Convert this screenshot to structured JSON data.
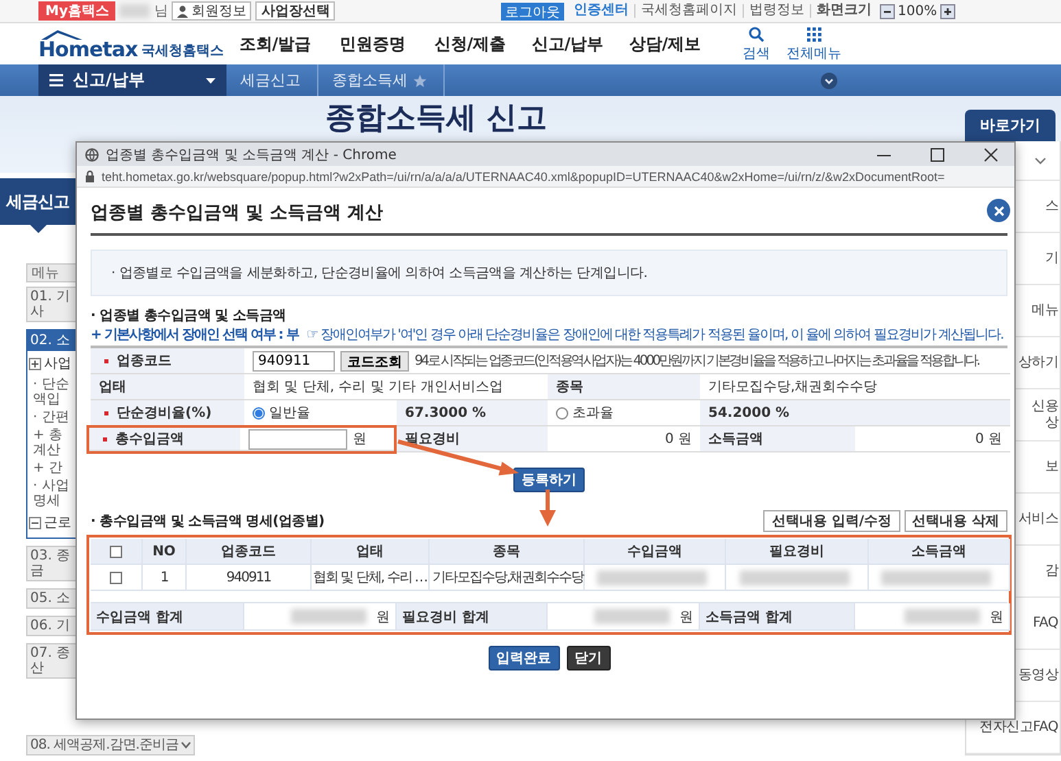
{
  "top_bar": {
    "my_button": "My홈택스",
    "user_suffix": "님",
    "member_info": "회원정보",
    "workplace": "사업장선택",
    "logout": "로그아웃",
    "cert": "인증센터",
    "links": [
      "국세청홈페이지",
      "법령정보"
    ],
    "zoom": {
      "label": "화면크기",
      "value": "100%"
    }
  },
  "header": {
    "logo": "Hometax",
    "logo_sub": "국세청홈택스",
    "nav": [
      "조회/발급",
      "민원증명",
      "신청/제출",
      "신고/납부",
      "상담/제보"
    ],
    "tools": [
      {
        "kind": "search",
        "label": "검색"
      },
      {
        "kind": "menu",
        "label": "전체메뉴"
      }
    ]
  },
  "breadcrumb": {
    "menu": "신고/납부",
    "items": [
      {
        "label": "세금신고"
      },
      {
        "label": "종합소득세",
        "favorite": false
      }
    ]
  },
  "banner": {
    "title": "종합소득세 신고"
  },
  "left_panel": {
    "title": "세금신고",
    "tab": "메뉴",
    "steps": [
      {
        "label": "01. 기\n사",
        "selected": false
      },
      {
        "label": "02. 소",
        "selected": true,
        "children": [
          {
            "label": "사업",
            "open": false,
            "children": [
              {
                "label": "· 단순\n액입"
              },
              {
                "label": "· 간편"
              },
              {
                "label": "+ 총\n계산"
              },
              {
                "label": "+ 간"
              },
              {
                "label": "· 사업\n명세"
              }
            ]
          },
          {
            "label": "근로",
            "open": true
          }
        ]
      },
      {
        "label": "03. 종\n금",
        "selected": false
      },
      {
        "label": "05. 소",
        "selected": false
      },
      {
        "label": "06. 기",
        "selected": false
      },
      {
        "label": "07. 종\n산",
        "selected": false
      },
      {
        "label": "08. 세액공제.감면.준비금",
        "selected": false,
        "dropdown": true
      }
    ]
  },
  "right_panel": {
    "title": "바로가기",
    "items": [
      "스",
      "기",
      "메뉴",
      "상하기",
      "신용\n상",
      "보",
      "서비스",
      "감",
      "FAQ",
      "동영상",
      "전자신고FAQ"
    ]
  },
  "popup": {
    "window_title": "업종별 총수입금액 및 소득금액 계산 - Chrome",
    "url": "teht.hometax.go.kr/websquare/popup.html?w2xPath=/ui/rn/a/a/a/a/UTERNAAC40.xml&popupID=UTERNAAC40&w2xHome=/ui/rn/z/&w2xDocumentRoot=",
    "heading": "업종별 총수입금액 및 소득금액 계산",
    "info": "· 업종별로 수입금액을 세분화하고, 단순경비율에 의하여 소득금액을 계산하는 단계입니다.",
    "section1": "· 업종별 총수입금액 및 소득금액",
    "note_label": "+ 기본사항에서 장애인 선택 여부 : 부",
    "note": "☞ 장애인여부가 '여'인 경우 아래 단순경비율은 장애인에 대한 적용특례가 적용된 율이며, 이 율에 의하여 필요경비가 계산됩니다.",
    "form_rows": [
      [
        {
          "kind": "label",
          "text": "업종코드",
          "required": true
        },
        {
          "kind": "code",
          "value": "940911",
          "button": "코드조회",
          "hint": "94로 시작되는 업종코드(인적용역사업자)는 4000만원까지 기본경비율을 적용하고 나머지는 초과율을 적용합니다."
        }
      ],
      [
        {
          "kind": "label",
          "text": "업태",
          "required": false
        },
        {
          "kind": "text",
          "text": "협회 및 단체, 수리 및 기타 개인서비스업"
        },
        {
          "kind": "label",
          "text": "종목",
          "required": false
        },
        {
          "kind": "text",
          "text": "기타모집수당,채권회수수당"
        }
      ],
      [
        {
          "kind": "label",
          "text": "단순경비율(%)",
          "required": true
        },
        {
          "kind": "radio",
          "text": "일반율",
          "selected": true
        },
        {
          "kind": "value",
          "text": "67.3000 %"
        },
        {
          "kind": "radio",
          "text": "초과율",
          "selected": false
        },
        {
          "kind": "value",
          "text": "54.2000 %"
        },
        {
          "kind": "empty"
        }
      ],
      [
        {
          "kind": "label",
          "text": "총수입금액",
          "required": true,
          "highlighted": true
        },
        {
          "kind": "input",
          "unit": "원"
        },
        {
          "kind": "label",
          "text": "필요경비",
          "required": false
        },
        {
          "kind": "amount",
          "text": "0 원"
        },
        {
          "kind": "label",
          "text": "소득금액",
          "required": false
        },
        {
          "kind": "amount",
          "text": "0 원"
        }
      ]
    ],
    "register_button": "등록하기",
    "section2": "· 총수입금액 및 소득금액 명세(업종별)",
    "actions": [
      "선택내용 입력/수정",
      "선택내용 삭제"
    ],
    "table": {
      "highlighted": true,
      "all_checked": false,
      "columns": [
        "NO",
        "업종코드",
        "업태",
        "종목",
        "수입금액",
        "필요경비",
        "소득금액"
      ],
      "rows": [
        {
          "checked": false,
          "cells": [
            {
              "text": "1"
            },
            {
              "text": "940911"
            },
            {
              "text": "협회 및 단체, 수리 …"
            },
            {
              "text": "기타모집수당,채권회수수당"
            },
            {
              "blurred": true
            },
            {
              "blurred": true
            },
            {
              "blurred": true
            }
          ]
        }
      ],
      "totals": [
        {
          "label": "수입금액 합계",
          "unit": "원",
          "blurred": true
        },
        {
          "label": "필요경비 합계",
          "unit": "원",
          "blurred": true
        },
        {
          "label": "소득금액 합계",
          "unit": "원",
          "blurred": true
        }
      ]
    },
    "footer_buttons": [
      {
        "kind": "primary",
        "label": "입력완료"
      },
      {
        "kind": "dark",
        "label": "닫기"
      }
    ]
  }
}
